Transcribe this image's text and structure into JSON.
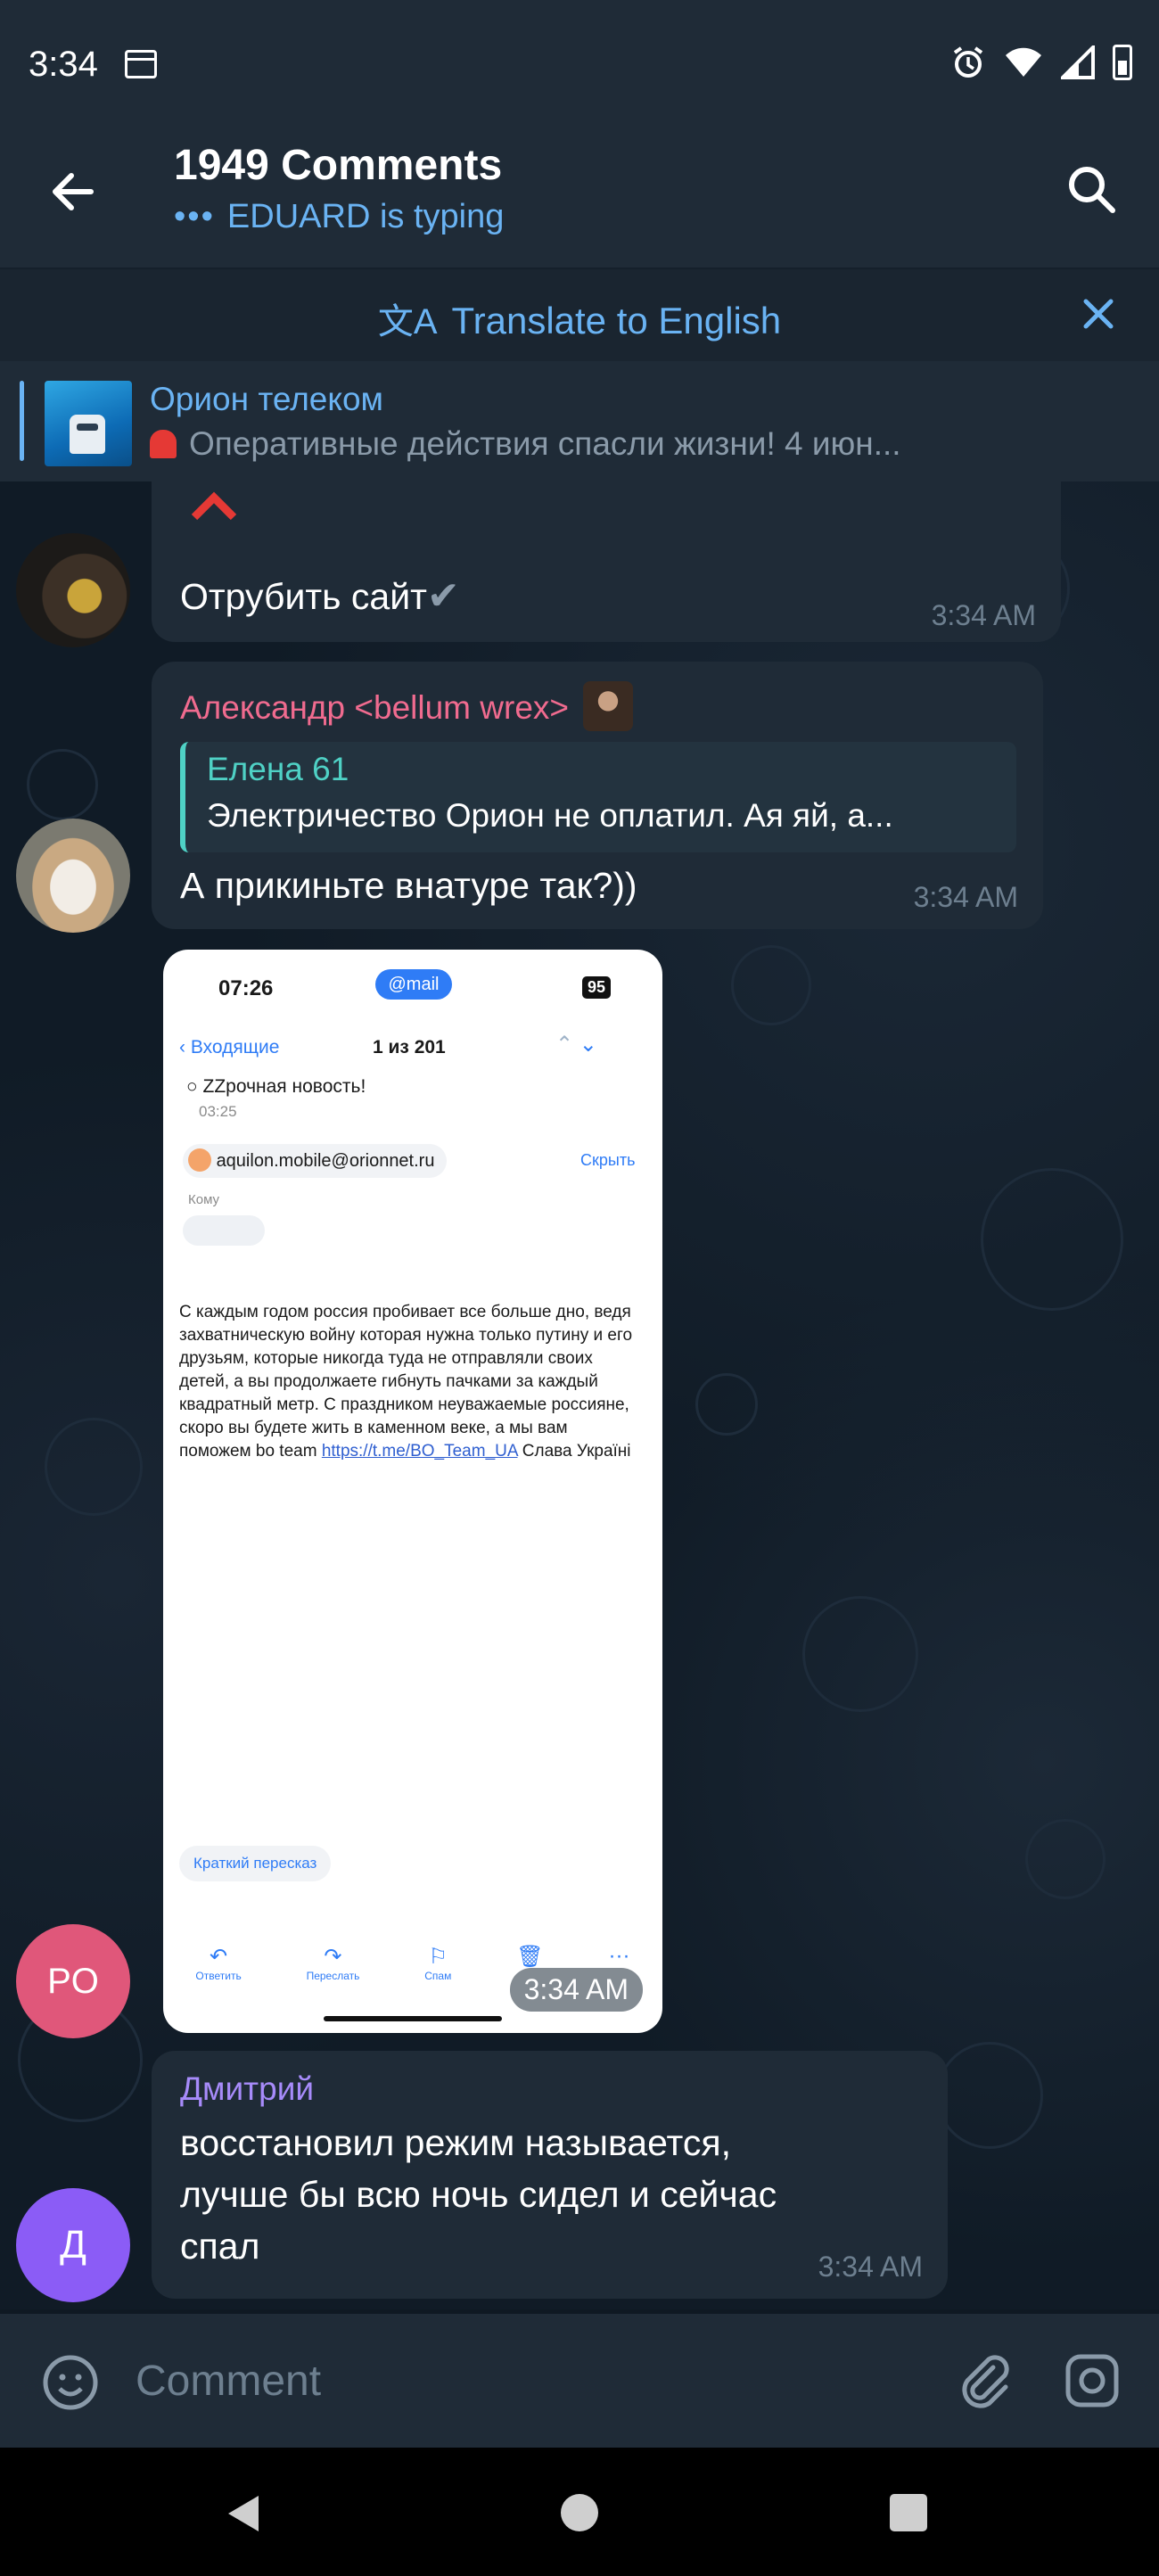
{
  "status": {
    "time": "3:34"
  },
  "header": {
    "title": "1949 Comments",
    "typing": "EDUARD is typing",
    "typing_dots": "•••"
  },
  "translate": {
    "label": "Translate to English"
  },
  "pinned": {
    "title": "Орион телеком",
    "text": "Оперативные действия спасли жизни!  4 июн..."
  },
  "messages": [
    {
      "text": "Отрубить сайт",
      "time": "3:34 AM"
    },
    {
      "sender": "Александр <bellum wrex>",
      "sender_color": "#f06b8f",
      "reply_name": "Елена 61",
      "reply_text": "Электричество Орион не оплатил. Ая яй, а...",
      "text": "А прикиньте внатуре так?))",
      "time": "3:34 AM"
    },
    {
      "avatar_initials": "PO",
      "avatar_color": "#e0577a",
      "time": "3:34 AM",
      "photo": {
        "phone_time": "07:26",
        "mail_badge": "@mail",
        "battery": "95",
        "back_label": "Входящие",
        "counter": "1 из 201",
        "subject": "ZZрочная новость!",
        "subject_time": "03:25",
        "sender_email": "aquilon.mobile@orionnet.ru",
        "hide_label": "Скрыть",
        "to_label": "Кому",
        "body": "С каждым годом россия пробивает все больше дно, ведя захватническую войну которая нужна только путину и его друзьям, которые никогда туда не отправляли своих детей, а вы продолжаете гибнуть пачками за каждый квадратный метр. С праздником неуважаемые россияне, скоро вы будете жить в каменном веке, а мы вам поможем bo team",
        "link": "https://t.me/BO_Team_UA",
        "body_tail": "Слава Україні",
        "summary_label": "Краткий пересказ",
        "actions": [
          "Ответить",
          "Переслать",
          "Спам",
          "",
          ""
        ]
      }
    },
    {
      "sender": "Дмитрий",
      "sender_color": "#a78bfa",
      "avatar_initials": "Д",
      "avatar_color": "#8b5cf6",
      "text_lines": [
        "восстановил режим называется,",
        "лучше бы всю ночь сидел и сейчас",
        "спал"
      ],
      "time": "3:34 AM"
    }
  ],
  "input": {
    "placeholder": "Comment"
  },
  "colors": {
    "accent": "#6ab3f3",
    "bubble": "#1f2b37",
    "background": "#0f1923"
  }
}
